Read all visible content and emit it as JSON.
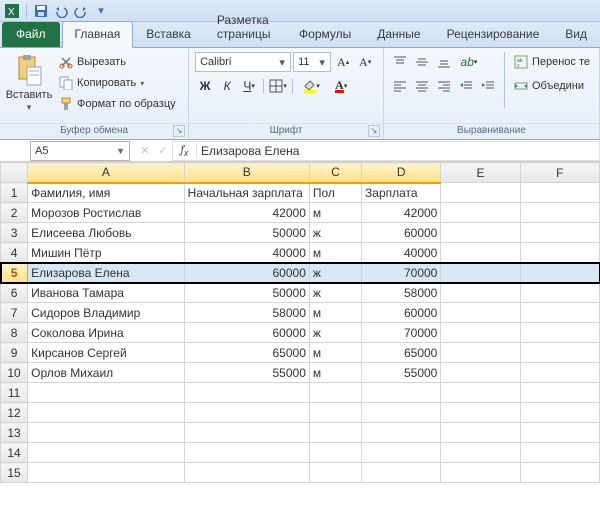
{
  "qat": {
    "save": "save",
    "undo": "undo",
    "redo": "redo"
  },
  "tabs": {
    "file": "Файл",
    "items": [
      "Главная",
      "Вставка",
      "Разметка страницы",
      "Формулы",
      "Данные",
      "Рецензирование",
      "Вид"
    ],
    "active_index": 0
  },
  "ribbon": {
    "clipboard": {
      "paste": "Вставить",
      "cut": "Вырезать",
      "copy": "Копировать",
      "format_painter": "Формат по образцу",
      "group": "Буфер обмена"
    },
    "font": {
      "name_value": "Calibri",
      "size_value": "11",
      "group": "Шрифт"
    },
    "alignment": {
      "wrap": "Перенос те",
      "merge": "Объедини",
      "group": "Выравнивание"
    }
  },
  "namebox": {
    "value": "A5"
  },
  "formula_bar": {
    "value": "Елизарова Елена"
  },
  "columns": [
    "A",
    "B",
    "C",
    "D",
    "E",
    "F"
  ],
  "selected_row_index": 4,
  "rows": [
    {
      "n": 1,
      "a": "Фамилия, имя",
      "b": "Начальная зарплата",
      "b_align": "left",
      "c": "Пол",
      "d": "Зарплата",
      "d_align": "left"
    },
    {
      "n": 2,
      "a": "Морозов Ростислав",
      "b": "42000",
      "c": "м",
      "d": "42000"
    },
    {
      "n": 3,
      "a": "Елисеева Любовь",
      "b": "50000",
      "c": "ж",
      "d": "60000"
    },
    {
      "n": 4,
      "a": "Мишин Пётр",
      "b": "40000",
      "c": "м",
      "d": "40000"
    },
    {
      "n": 5,
      "a": "Елизарова Елена",
      "b": "60000",
      "c": "ж",
      "d": "70000"
    },
    {
      "n": 6,
      "a": "Иванова Тамара",
      "b": "50000",
      "c": "ж",
      "d": "58000"
    },
    {
      "n": 7,
      "a": "Сидоров Владимир",
      "b": "58000",
      "c": "м",
      "d": "60000"
    },
    {
      "n": 8,
      "a": "Соколова Ирина",
      "b": "60000",
      "c": "ж",
      "d": "70000"
    },
    {
      "n": 9,
      "a": "Кирсанов Сергей",
      "b": "65000",
      "c": "м",
      "d": "65000"
    },
    {
      "n": 10,
      "a": "Орлов Михаил",
      "b": "55000",
      "c": "м",
      "d": "55000"
    },
    {
      "n": 11,
      "a": "",
      "b": "",
      "c": "",
      "d": ""
    },
    {
      "n": 12,
      "a": "",
      "b": "",
      "c": "",
      "d": ""
    },
    {
      "n": 13,
      "a": "",
      "b": "",
      "c": "",
      "d": ""
    },
    {
      "n": 14,
      "a": "",
      "b": "",
      "c": "",
      "d": ""
    },
    {
      "n": 15,
      "a": "",
      "b": "",
      "c": "",
      "d": ""
    }
  ]
}
